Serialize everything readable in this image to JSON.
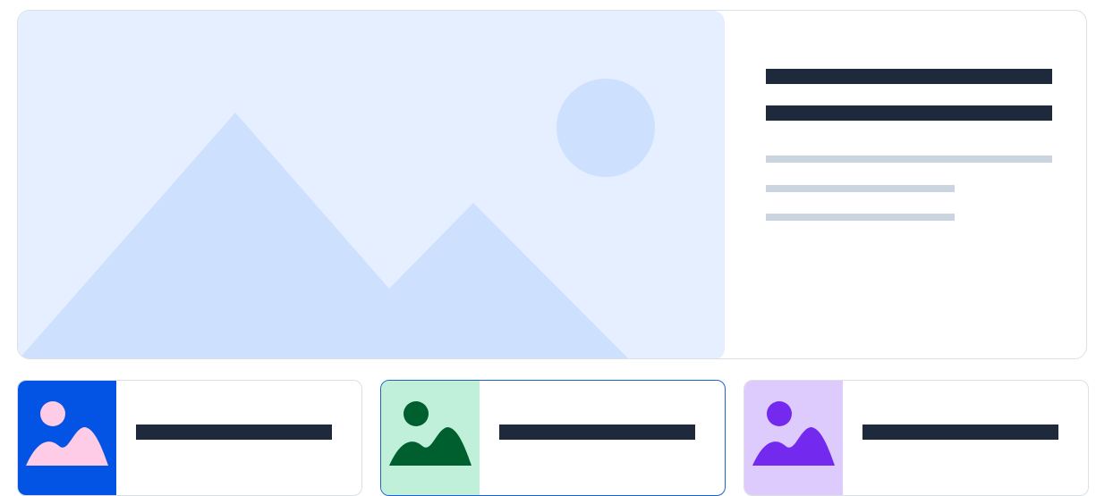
{
  "hero": {
    "media_icon": "image-placeholder-icon",
    "colors": {
      "background": "#e6efff",
      "shapes": "#cde0fe"
    }
  },
  "cards": [
    {
      "icon": "image-placeholder-icon",
      "thumb_bg": "#0354e4",
      "fg": "#fecce6",
      "selected": false
    },
    {
      "icon": "image-placeholder-icon",
      "thumb_bg": "#c1f0da",
      "fg": "#005f2e",
      "selected": true
    },
    {
      "icon": "image-placeholder-icon",
      "thumb_bg": "#ddcbfe",
      "fg": "#7329ee",
      "selected": false
    }
  ]
}
